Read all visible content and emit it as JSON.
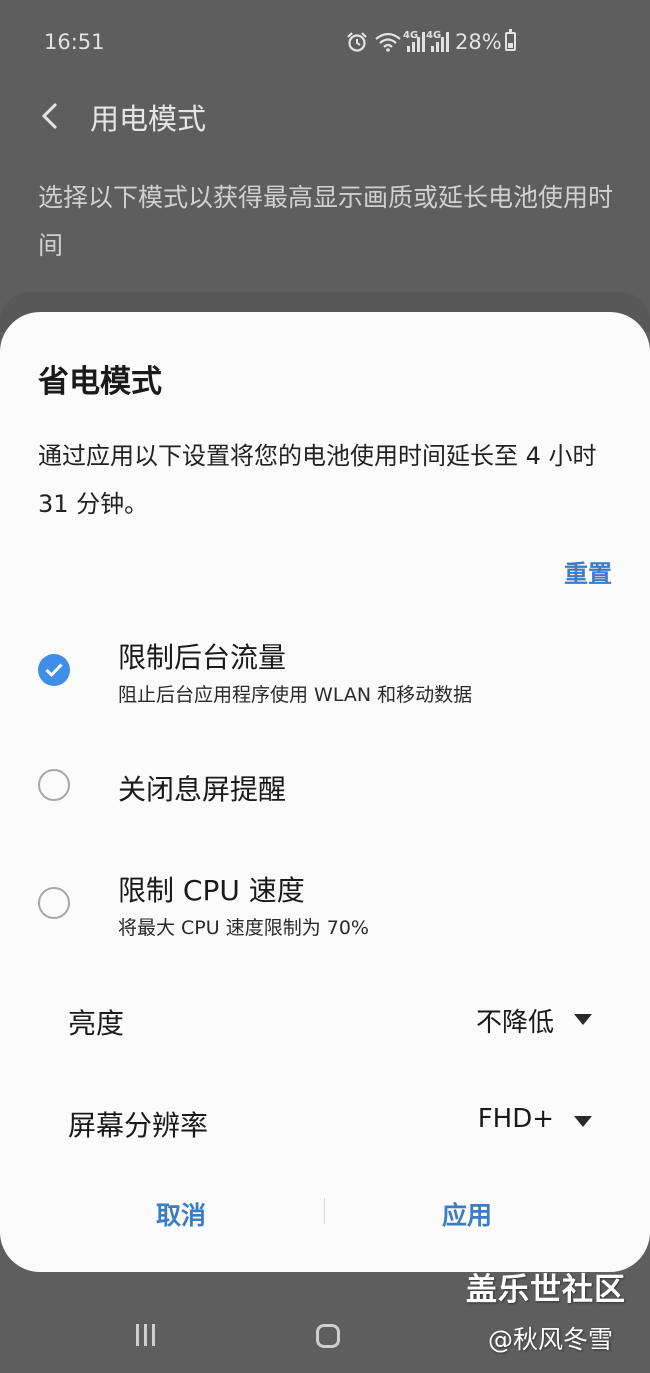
{
  "status_bar": {
    "time": "16:51",
    "network_label_1": "4G",
    "network_label_2": "4G",
    "battery": "28%",
    "icons": [
      "alarm-icon",
      "wifi-icon",
      "signal-icon",
      "signal-icon",
      "battery-icon"
    ]
  },
  "header": {
    "title": "用电模式"
  },
  "background_description": "选择以下模式以获得最高显示画质或延长电池使用时间",
  "dialog": {
    "title": "省电模式",
    "description": "通过应用以下设置将您的电池使用时间延长至 4 小时 31 分钟。",
    "reset_label": "重置",
    "options": [
      {
        "title": "限制后台流量",
        "subtitle": "阻止后台应用程序使用 WLAN 和移动数据",
        "checked": true
      },
      {
        "title": "关闭息屏提醒",
        "subtitle": "",
        "checked": false
      },
      {
        "title": "限制 CPU 速度",
        "subtitle": "将最大 CPU 速度限制为 70%",
        "checked": false
      }
    ],
    "settings": [
      {
        "label": "亮度",
        "value": "不降低"
      },
      {
        "label": "屏幕分辨率",
        "value": "FHD+"
      }
    ],
    "cancel_label": "取消",
    "apply_label": "应用"
  },
  "watermark": {
    "line1": "盖乐世社区",
    "line2": "@秋风冬雪"
  },
  "colors": {
    "accent": "#3b7cc4",
    "check": "#3f8ee8",
    "dim_background": "#5e5e5e",
    "dialog_background": "#fbfbfb"
  }
}
